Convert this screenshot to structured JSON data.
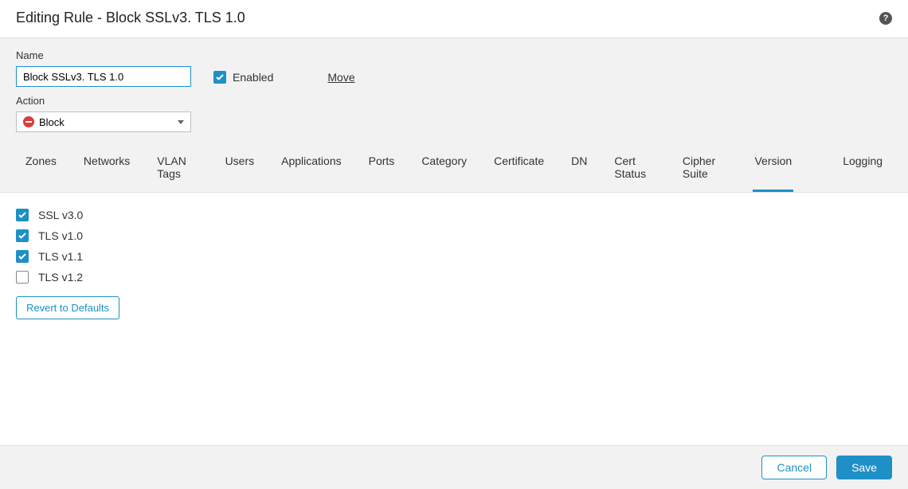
{
  "header": {
    "title": "Editing Rule - Block SSLv3. TLS 1.0"
  },
  "form": {
    "name_label": "Name",
    "name_value": "Block SSLv3. TLS 1.0",
    "enabled_label": "Enabled",
    "enabled_checked": true,
    "move_label": "Move",
    "action_label": "Action",
    "action_value": "Block"
  },
  "tabs": [
    {
      "label": "Zones"
    },
    {
      "label": "Networks"
    },
    {
      "label": "VLAN Tags"
    },
    {
      "label": "Users"
    },
    {
      "label": "Applications"
    },
    {
      "label": "Ports"
    },
    {
      "label": "Category"
    },
    {
      "label": "Certificate"
    },
    {
      "label": "DN"
    },
    {
      "label": "Cert Status"
    },
    {
      "label": "Cipher Suite"
    },
    {
      "label": "Version",
      "active": true
    }
  ],
  "tabs_right": [
    {
      "label": "Logging"
    }
  ],
  "versions": [
    {
      "label": "SSL v3.0",
      "checked": true
    },
    {
      "label": "TLS v1.0",
      "checked": true
    },
    {
      "label": "TLS v1.1",
      "checked": true
    },
    {
      "label": "TLS v1.2",
      "checked": false
    }
  ],
  "buttons": {
    "revert": "Revert to Defaults",
    "cancel": "Cancel",
    "save": "Save"
  }
}
